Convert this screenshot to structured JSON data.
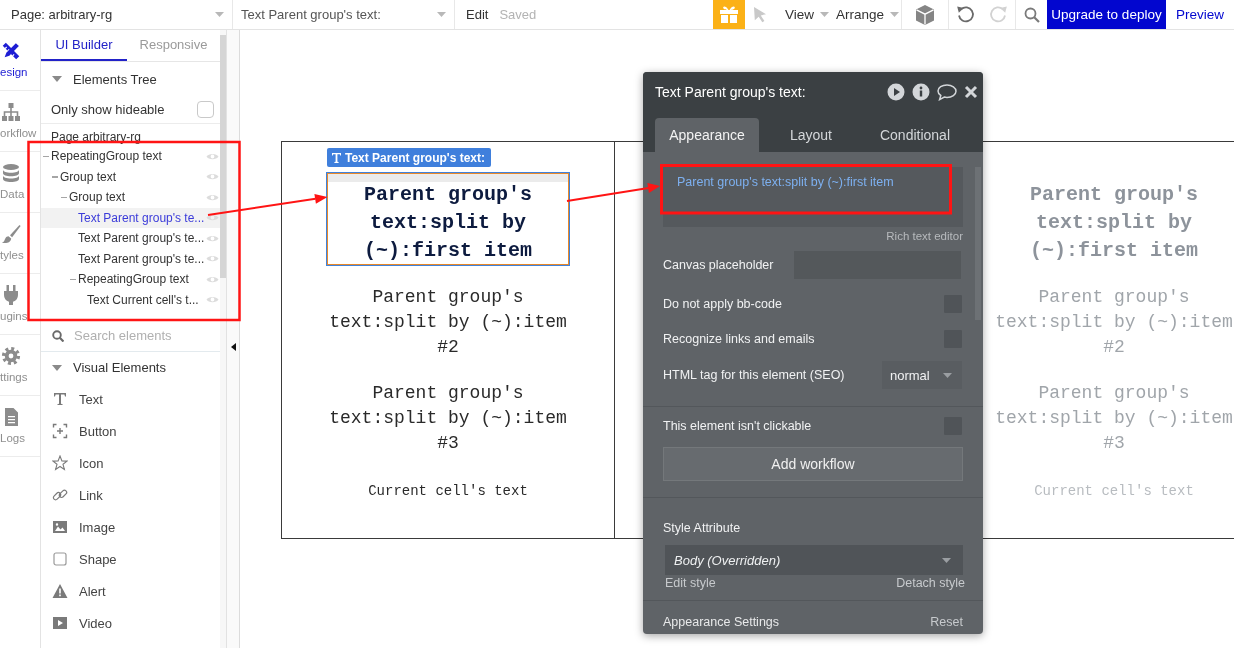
{
  "top_bar": {
    "page_selector": "Page: arbitrary-rg",
    "element_selector": "Text Parent group's text:",
    "edit_label": "Edit",
    "save_status": "Saved",
    "menus": [
      {
        "label": "View"
      },
      {
        "label": "Arrange"
      }
    ],
    "upgrade_button": "Upgrade to deploy",
    "preview_link": "Preview"
  },
  "nav_rail": [
    {
      "kind": "design",
      "label": "esign",
      "selected": true
    },
    {
      "kind": "workflow",
      "label": "orkflow",
      "selected": false
    },
    {
      "kind": "data",
      "label": "Data",
      "selected": false
    },
    {
      "kind": "styles",
      "label": "tyles",
      "selected": false
    },
    {
      "kind": "plugins",
      "label": "ugins",
      "selected": false
    },
    {
      "kind": "settings",
      "label": "ttings",
      "selected": false
    },
    {
      "kind": "logs",
      "label": "Logs",
      "selected": false
    }
  ],
  "builder_panel": {
    "tabs": [
      {
        "label": "UI Builder",
        "selected": true
      },
      {
        "label": "Responsive",
        "selected": false
      }
    ],
    "elements_tree": {
      "title": "Elements Tree",
      "expanded": true,
      "filter_label": "Only show hideable",
      "filter_checked": false,
      "page_label": "Page arbitrary-rg",
      "items": [
        {
          "label": "RepeatingGroup text",
          "selected": false,
          "expanded": true,
          "children": [
            {
              "label": "Group text",
              "selected": false,
              "expanded": true,
              "children": [
                {
                  "label": "Group text",
                  "selected": false,
                  "expanded": true,
                  "children": [
                    {
                      "label": "Text Parent group's te...",
                      "selected": true
                    },
                    {
                      "label": "Text Parent group's te...",
                      "selected": false
                    },
                    {
                      "label": "Text Parent group's te...",
                      "selected": false
                    },
                    {
                      "label": "RepeatingGroup text",
                      "selected": false,
                      "expanded": true,
                      "children": [
                        {
                          "label": "Text Current cell's t...",
                          "selected": false
                        }
                      ]
                    }
                  ]
                }
              ]
            }
          ]
        }
      ]
    },
    "search": {
      "placeholder": "Search elements"
    },
    "visual_elements": {
      "title": "Visual Elements",
      "expanded": true,
      "items": [
        {
          "kind": "text",
          "label": "Text"
        },
        {
          "kind": "button",
          "label": "Button"
        },
        {
          "kind": "icon",
          "label": "Icon"
        },
        {
          "kind": "link",
          "label": "Link"
        },
        {
          "kind": "image",
          "label": "Image"
        },
        {
          "kind": "shape",
          "label": "Shape"
        },
        {
          "kind": "alert",
          "label": "Alert"
        },
        {
          "kind": "video",
          "label": "Video"
        }
      ]
    }
  },
  "canvas": {
    "element_tag": "Text Parent group's text:",
    "cells": [
      {
        "dimmed": false,
        "texts": [
          {
            "kind": "heading",
            "text": "Parent group's text:split by (~):first item",
            "selected": true
          },
          {
            "kind": "body",
            "text": "Parent group's text:split by (~):item #2",
            "selected": false
          },
          {
            "kind": "body",
            "text": "Parent group's text:split by (~):item #3",
            "selected": false
          },
          {
            "kind": "caption",
            "text": "Current cell's text",
            "selected": false
          }
        ]
      },
      {
        "dimmed": true,
        "texts": [
          {
            "kind": "heading",
            "text": "Parent group's text:split by (~):first item",
            "selected": false
          },
          {
            "kind": "body",
            "text": "Parent group's text:split by (~):item #2",
            "selected": false
          },
          {
            "kind": "body",
            "text": "Parent group's text:split by (~):item #3",
            "selected": false
          },
          {
            "kind": "caption",
            "text": "Current cell's text",
            "selected": false
          }
        ]
      }
    ]
  },
  "property_editor": {
    "title": "Text Parent group's text:",
    "tabs": [
      {
        "label": "Appearance",
        "selected": true
      },
      {
        "label": "Layout",
        "selected": false
      },
      {
        "label": "Conditional",
        "selected": false
      }
    ],
    "content_value": "Parent group's text:split by (~):first item",
    "rich_text_link": "Rich text editor",
    "placeholder_label": "Canvas placeholder",
    "options": [
      {
        "label": "Do not apply bb-code",
        "checked": false
      },
      {
        "label": "Recognize links and emails",
        "checked": false
      }
    ],
    "html_tag": {
      "label": "HTML tag for this element (SEO)",
      "value": "normal"
    },
    "clickable_option": {
      "label": "This element isn't clickable",
      "checked": false
    },
    "add_workflow_button": "Add workflow",
    "style": {
      "label": "Style Attribute",
      "value": "Body (Overridden)",
      "edit_link": "Edit style",
      "detach_link": "Detach style"
    },
    "settings_section": {
      "title": "Appearance Settings",
      "reset_link": "Reset"
    }
  }
}
